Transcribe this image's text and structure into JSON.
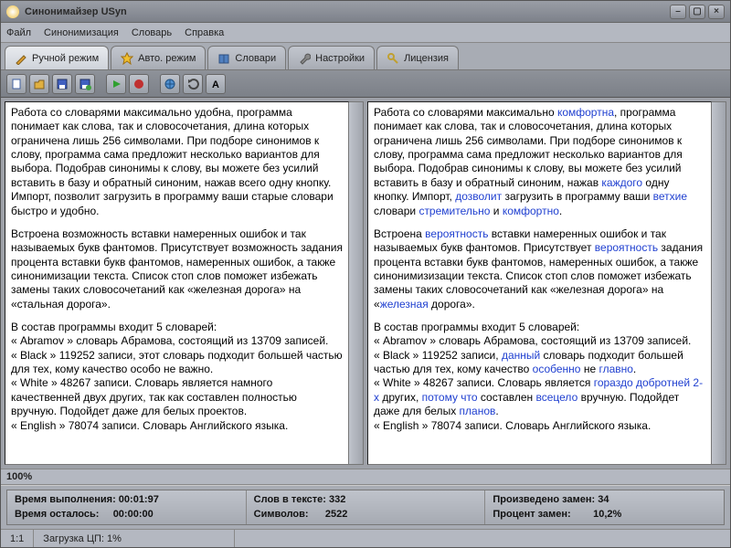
{
  "title": "Синонимайзер USyn",
  "menu": {
    "file": "Файл",
    "syn": "Синонимизация",
    "dict": "Словарь",
    "help": "Справка"
  },
  "tabs": {
    "manual": "Ручной режим",
    "auto": "Авто. режим",
    "dicts": "Словари",
    "settings": "Настройки",
    "license": "Лицензия"
  },
  "left": {
    "p1": "Работа со словарями максимально удобна, программа понимает как слова, так и словосочетания, длина которых ограничена лишь 256 символами. При подборе синонимов к слову, программа сама предложит несколько вариантов для выбора. Подобрав синонимы к слову, вы можете без усилий вставить в базу и обратный синоним, нажав всего одну кнопку. Импорт, позволит загрузить в программу ваши старые словари быстро и удобно.",
    "p2": "Встроена возможность вставки намеренных ошибок и так называемых букв фантомов. Присутствует возможность задания процента вставки букв фантомов, намеренных ошибок, а также синонимизации текста. Список стоп слов поможет избежать замены таких словосочетаний как «железная дорога» на «стальная дорога».",
    "p3a": "В состав программы входит 5 словарей:",
    "p3b": "« Abramov » словарь Абрамова, состоящий из 13709 записей.",
    "p3c": "« Black » 119252 записи, этот словарь подходит большей частью для тех, кому качество особо не важно.",
    "p3d": "« White » 48267 записи. Словарь является намного качественней двух других, так как составлен полностью вручную.  Подойдет даже для белых проектов.",
    "p3e": "« English » 78074 записи. Словарь Английского языка."
  },
  "right": {
    "words": {
      "w1": "комфортна",
      "w2": "каждого",
      "w3": "дозволит",
      "w4": "ветхие",
      "w5": "стремительно",
      "w6": "комфортно",
      "w7": "вероятность",
      "w8": "вероятность",
      "w9": "железная",
      "w10": "данный",
      "w11": "особенно",
      "w12": "главно",
      "w13": "гораздо добротней 2-х",
      "w14": "потому что",
      "w15": "всецело",
      "w16": "планов"
    }
  },
  "progress": "100%",
  "stats": {
    "c1a": "Время выполнения:",
    "c1av": "00:01:97",
    "c1b": "Время осталось:",
    "c1bv": "00:00:00",
    "c2a": "Слов в тексте:",
    "c2av": "332",
    "c2b": "Символов:",
    "c2bv": "2522",
    "c3a": "Произведено замен:",
    "c3av": "34",
    "c3b": "Процент замен:",
    "c3bv": "10,2%"
  },
  "status": {
    "pos": "1:1",
    "cpu": "Загрузка ЦП: 1%"
  }
}
